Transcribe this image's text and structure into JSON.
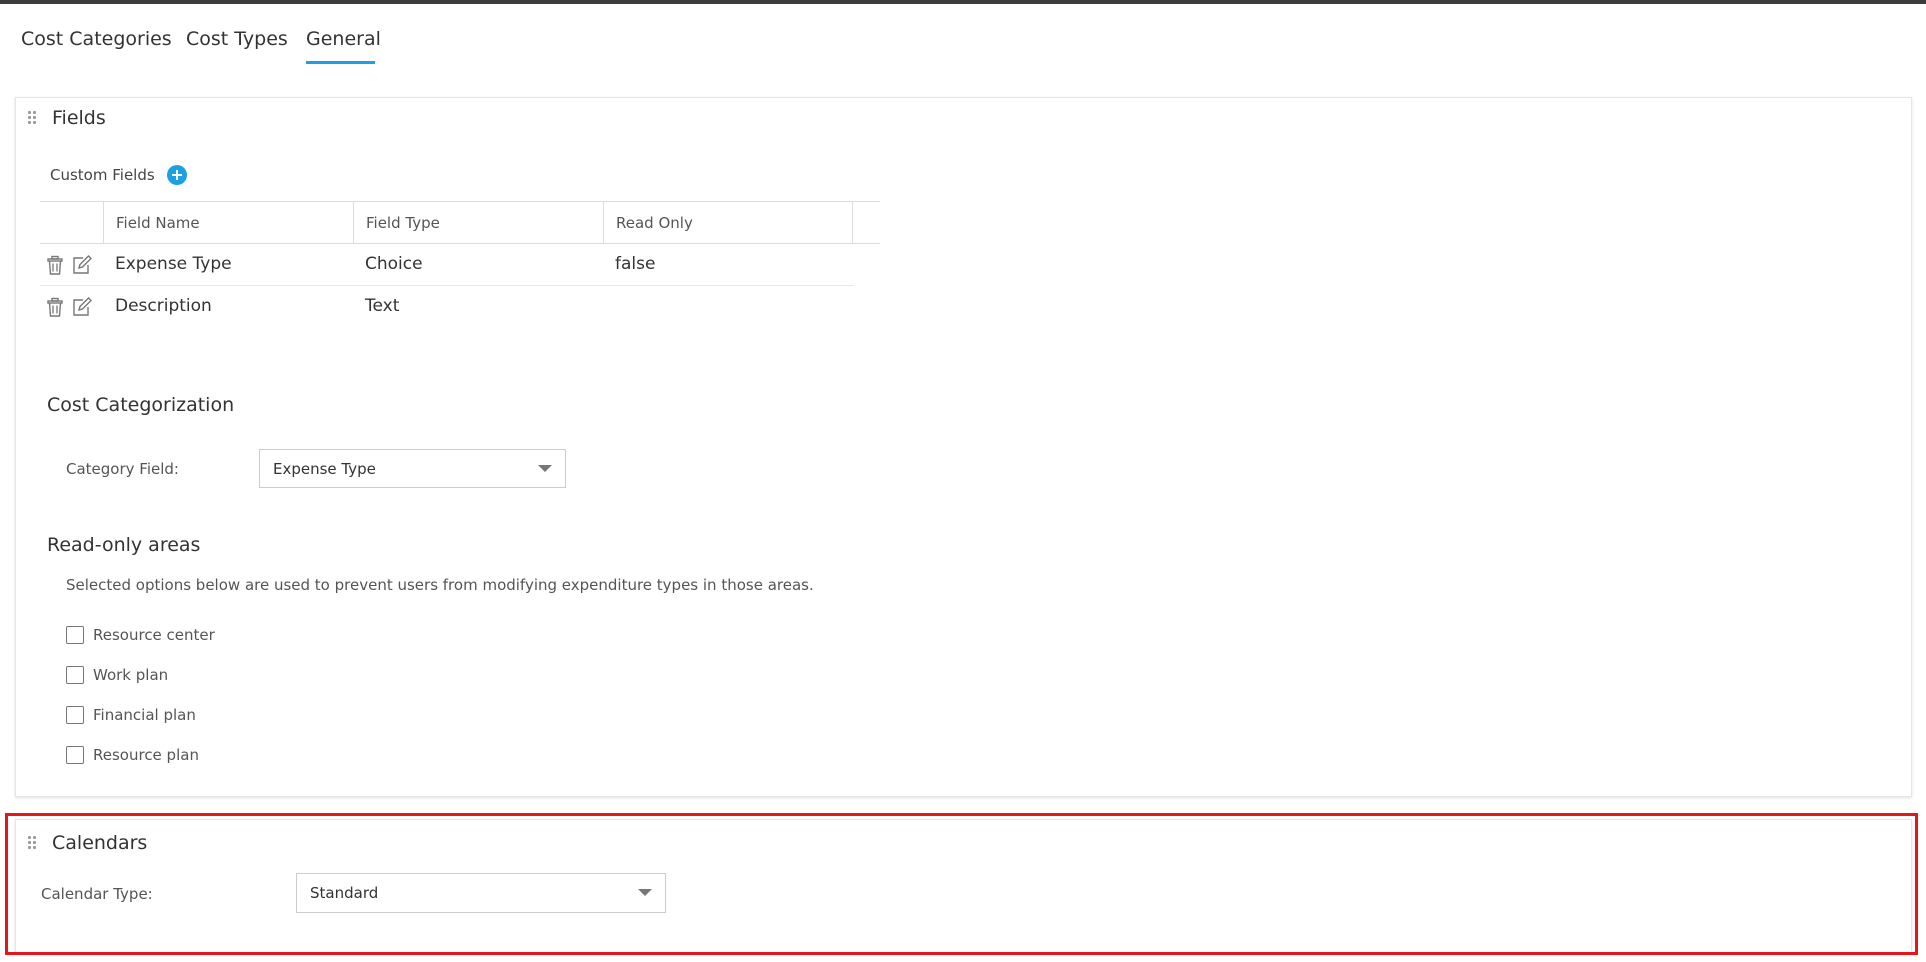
{
  "tabs": [
    {
      "label": "Cost Categories",
      "active": false
    },
    {
      "label": "Cost Types",
      "active": false
    },
    {
      "label": "General",
      "active": true
    }
  ],
  "accent_color": "#1ba1e2",
  "highlight_color": "#e3161b",
  "fields_card": {
    "title": "Fields",
    "custom_fields_label": "Custom Fields",
    "add_icon": "plus-circle-icon",
    "table": {
      "columns": [
        "Field Name",
        "Field Type",
        "Read Only"
      ],
      "rows": [
        {
          "field_name": "Expense Type",
          "field_type": "Choice",
          "read_only": "false"
        },
        {
          "field_name": "Description",
          "field_type": "Text",
          "read_only": ""
        }
      ],
      "row_actions": [
        "trash-icon",
        "edit-icon"
      ]
    },
    "cost_categorization": {
      "title": "Cost Categorization",
      "category_field_label": "Category Field:",
      "category_field_value": "Expense Type"
    },
    "read_only_areas": {
      "title": "Read-only areas",
      "description": "Selected options below are used to prevent users from modifying expenditure types in those areas.",
      "options": [
        {
          "label": "Resource center",
          "checked": false
        },
        {
          "label": "Work plan",
          "checked": false
        },
        {
          "label": "Financial plan",
          "checked": false
        },
        {
          "label": "Resource plan",
          "checked": false
        }
      ]
    }
  },
  "calendars_card": {
    "title": "Calendars",
    "calendar_type_label": "Calendar Type:",
    "calendar_type_value": "Standard"
  }
}
